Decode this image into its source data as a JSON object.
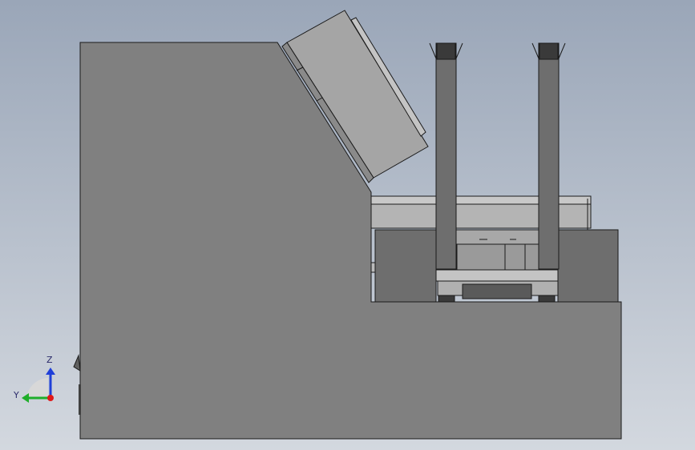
{
  "viewport": {
    "background_top": "#9aa6b8",
    "background_bottom": "#d3d8df"
  },
  "model": {
    "body_color": "#808080",
    "part_color": "#6e6e6e",
    "part_light": "#a5a5a5",
    "edge_color": "#1a1a1a",
    "cap_color": "#3a3a3a"
  },
  "triad": {
    "z_label": "Z",
    "y_label": "Y",
    "z_color": "#1f3fd8",
    "y_color": "#1fae2a",
    "origin_color": "#e01818",
    "label_color": "#2a2a6a"
  }
}
